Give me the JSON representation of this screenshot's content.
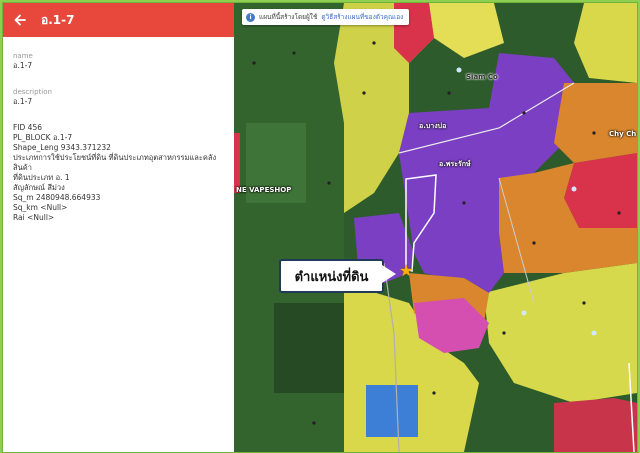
{
  "header": {
    "title": "อ.1-7"
  },
  "fields": [
    {
      "label": "name",
      "value": "อ.1-7"
    },
    {
      "label": "description",
      "value": "อ.1-7"
    }
  ],
  "attributes": [
    "FID 456",
    "PL_BLOCK อ.1-7",
    "Shape_Leng 9343.371232",
    "ประเภทการใช้ประโยชน์ที่ดิน ที่ดินประเภทอุตสาหกรรมและคลัง",
    "สินค้า",
    "ที่ดินประเภท อ. 1",
    "สัญลักษณ์ สีม่วง",
    "Sq_m 2480948.664933",
    "Sq_km <Null>",
    "Rai <Null>"
  ],
  "map": {
    "notice_text": "แผนที่นี้สร้างโดยผู้ใช้",
    "notice_link": "ดูวิธีสร้างแผนที่ของตัวคุณเอง",
    "callout_text": "ตำแหน่งที่ดิน",
    "labels": {
      "road_1": "อ.บางบ่อ",
      "road_2": "อ.พระรักษ์",
      "place_1": "NE VAPESHOP",
      "place_2": "Chy Ch",
      "place_3": "Siam Co"
    }
  },
  "colors": {
    "header": "#e8473c",
    "industrial_purple": "#7b3fc4",
    "commercial_orange": "#d9862e",
    "residential_yellow": "#d8d84a",
    "red_zone": "#d8334a",
    "pink_zone": "#d44fb0",
    "blue_zone": "#3d7fd6"
  }
}
